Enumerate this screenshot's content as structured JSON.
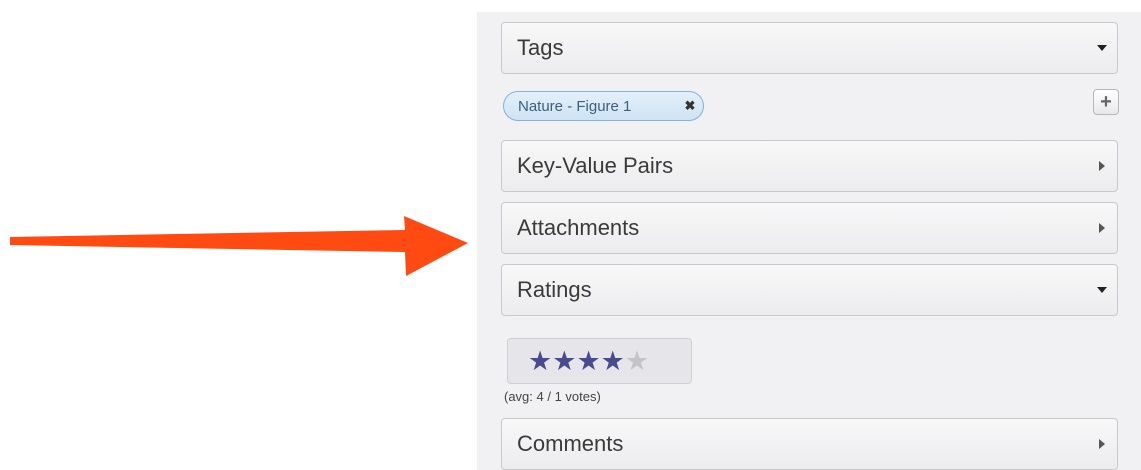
{
  "colors": {
    "arrow": "#ff4a12",
    "star_on": "#4a4a90",
    "star_off": "#c4c4c8",
    "tag_bg": "#d8e9f6"
  },
  "sections": {
    "tags": {
      "label": "Tags",
      "state": "expanded"
    },
    "key_value_pairs": {
      "label": "Key-Value Pairs",
      "state": "collapsed"
    },
    "attachments": {
      "label": "Attachments",
      "state": "collapsed"
    },
    "ratings": {
      "label": "Ratings",
      "state": "expanded"
    },
    "comments": {
      "label": "Comments",
      "state": "collapsed"
    }
  },
  "tags": {
    "items": [
      {
        "label": "Nature - Figure 1",
        "remove_icon": "close-icon"
      }
    ],
    "add_icon": "plus-icon"
  },
  "rating": {
    "value": 4,
    "max": 5,
    "average_text": "(avg: 4 / 1 votes)"
  }
}
